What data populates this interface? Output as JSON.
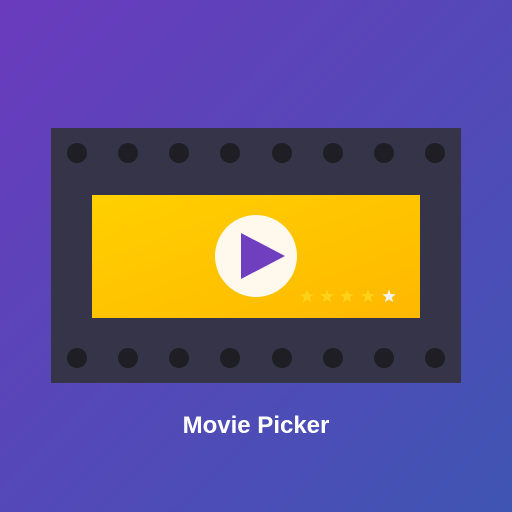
{
  "app": {
    "title": "Movie Picker"
  },
  "theme": {
    "background_gradient_start": "#6a3bbd",
    "background_gradient_end": "#3f55b3",
    "film_strip": "#353448",
    "sprocket_holes": "#1e1e24",
    "screen_gradient_start": "#ffd000",
    "screen_gradient_end": "#ffb800",
    "play_button": "#fff8ec",
    "play_triangle": "#6f3fbf",
    "star_filled": "#ffd21a",
    "star_empty": "#f3f3f3"
  },
  "icons": {
    "main": "film-strip-icon",
    "play": "play-icon",
    "rating": "star-icon"
  },
  "rating": {
    "value": 4,
    "max": 5
  }
}
